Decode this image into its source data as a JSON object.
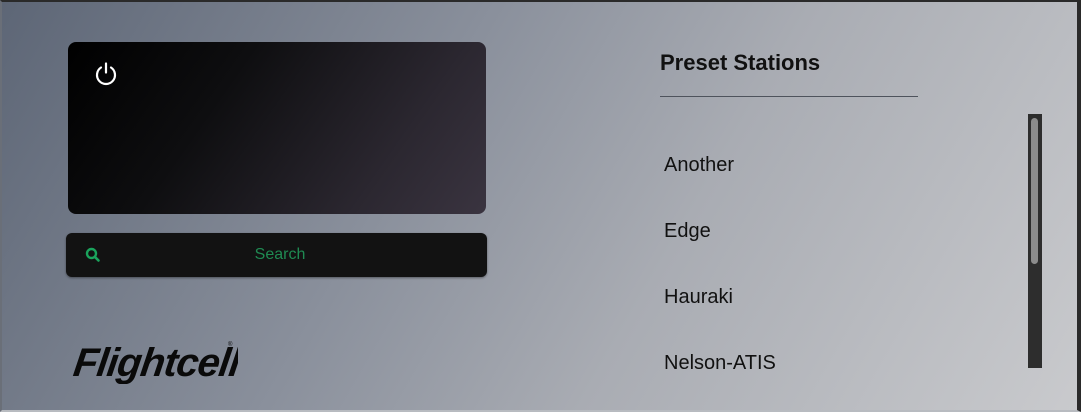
{
  "display": {
    "power_icon": "power-icon"
  },
  "search": {
    "icon": "search-icon",
    "placeholder": "Search",
    "value": ""
  },
  "brand": {
    "logo_text": "Flightcell"
  },
  "presets": {
    "title": "Preset Stations",
    "stations": [
      {
        "label": "Another"
      },
      {
        "label": "Edge"
      },
      {
        "label": "Hauraki"
      },
      {
        "label": "Nelson-ATIS"
      }
    ]
  },
  "colors": {
    "accent": "#1aa35c",
    "display_bg": "#000000",
    "search_bg": "#121212",
    "text": "#111111"
  }
}
